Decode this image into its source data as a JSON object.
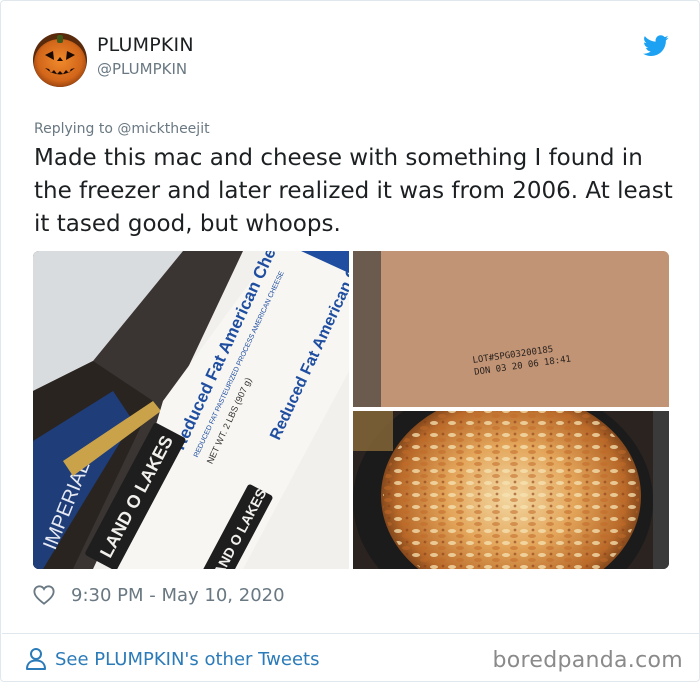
{
  "author": {
    "display_name": "PLUMPKIN",
    "handle": "@PLUMPKIN",
    "avatar_icon": "pumpkin-jack-o-lantern"
  },
  "brand": {
    "icon": "twitter-bird-icon",
    "color": "#1da1f2"
  },
  "tweet": {
    "reply_to": "Replying to @micktheejit",
    "text": "Made this mac and cheese with something I found in the freezer and later realized it was from 2006. At least it tased good, but whoops.",
    "timestamp": "9:30 PM - May 10, 2020"
  },
  "media": {
    "box_text": {
      "brand": "LAND O LAKES",
      "product": "Reduced Fat American Cheese",
      "product_repeat": "Reduced Fat American Cheese",
      "detail_line": "REDUCED FAT PASTEURIZED PROCESS AMERICAN CHEESE",
      "net_wt": "NET WT. 2 LBS (907 g)",
      "side_box": "IMPERIAL"
    },
    "stamp": {
      "line1": "LOT#SPG03200185",
      "line2": "DON  03 20 06  18:41"
    }
  },
  "footer": {
    "see_other": "See PLUMPKIN's other Tweets",
    "watermark": "boredpanda.com"
  },
  "colors": {
    "text": "#1c2022",
    "muted": "#697882",
    "link": "#2b7bb9",
    "border": "#e1e8ed"
  }
}
